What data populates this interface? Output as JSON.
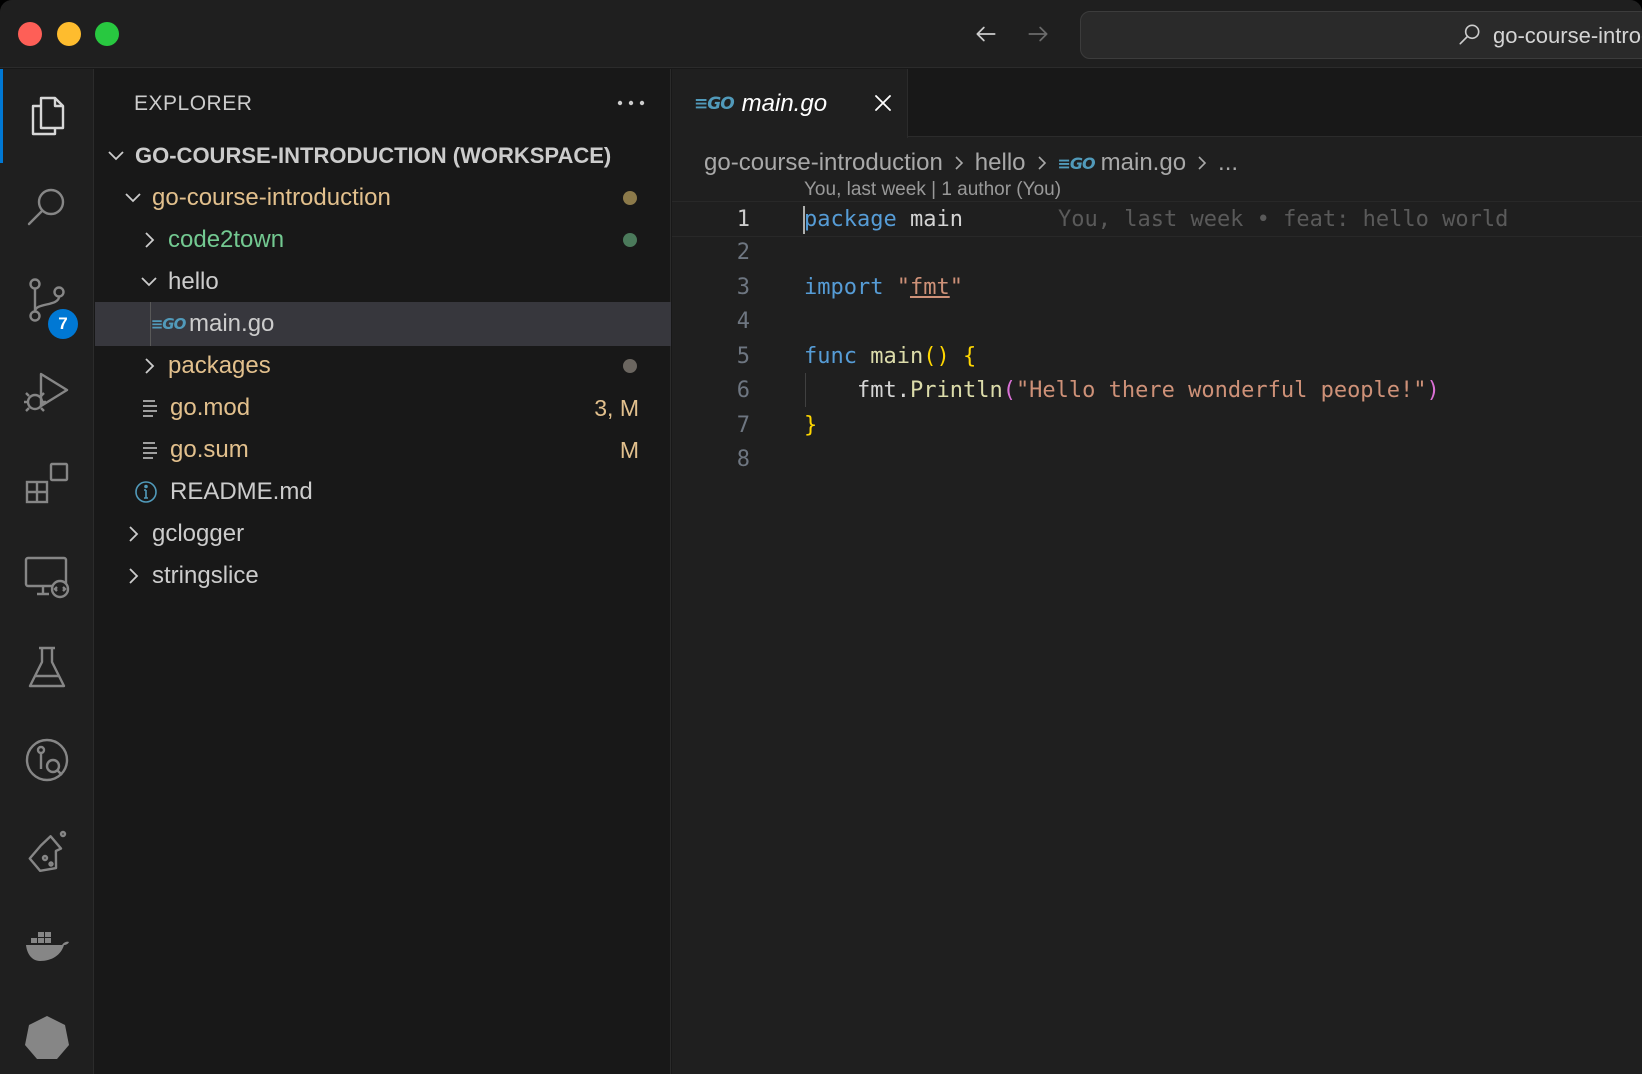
{
  "titlebar": {
    "search_text": "go-course-introduction"
  },
  "activity_bar": {
    "source_control_badge": "7"
  },
  "explorer": {
    "title": "EXPLORER",
    "workspace": "GO-COURSE-INTRODUCTION (WORKSPACE)",
    "items": [
      {
        "label": "go-course-introduction",
        "status": ""
      },
      {
        "label": "code2town",
        "status": ""
      },
      {
        "label": "hello",
        "status": ""
      },
      {
        "label": "main.go",
        "status": ""
      },
      {
        "label": "packages",
        "status": ""
      },
      {
        "label": "go.mod",
        "status": "3, M"
      },
      {
        "label": "go.sum",
        "status": "M"
      },
      {
        "label": "README.md",
        "status": ""
      },
      {
        "label": "gclogger",
        "status": ""
      },
      {
        "label": "stringslice",
        "status": ""
      }
    ]
  },
  "editor": {
    "tab": {
      "icon_text": "GO",
      "label": "main.go"
    },
    "breadcrumb": [
      "go-course-introduction",
      "hello",
      "main.go",
      "..."
    ],
    "codelens": "You, last week | 1 author (You)",
    "blame": "You, last week • feat: hello world",
    "line_numbers": [
      "1",
      "2",
      "3",
      "4",
      "5",
      "6",
      "7",
      "8"
    ],
    "code": {
      "l1_kw": "package",
      "l1_rest": " main",
      "l3_kw": "import",
      "l3_q1": " \"",
      "l3_pkg": "fmt",
      "l3_q2": "\"",
      "l5_kw": "func",
      "l5_fn": " main",
      "l5_paren": "()",
      "l5_brace": " {",
      "l6_obj": "    fmt.",
      "l6_fn": "Println",
      "l6_open": "(",
      "l6_str": "\"Hello there wonderful people!\"",
      "l6_close": ")",
      "l7_brace": "}"
    }
  },
  "colors": {
    "accent": "#0078d4",
    "git_modified": "#e2c08d",
    "git_untracked": "#73c991",
    "go_icon": "#519aba"
  }
}
